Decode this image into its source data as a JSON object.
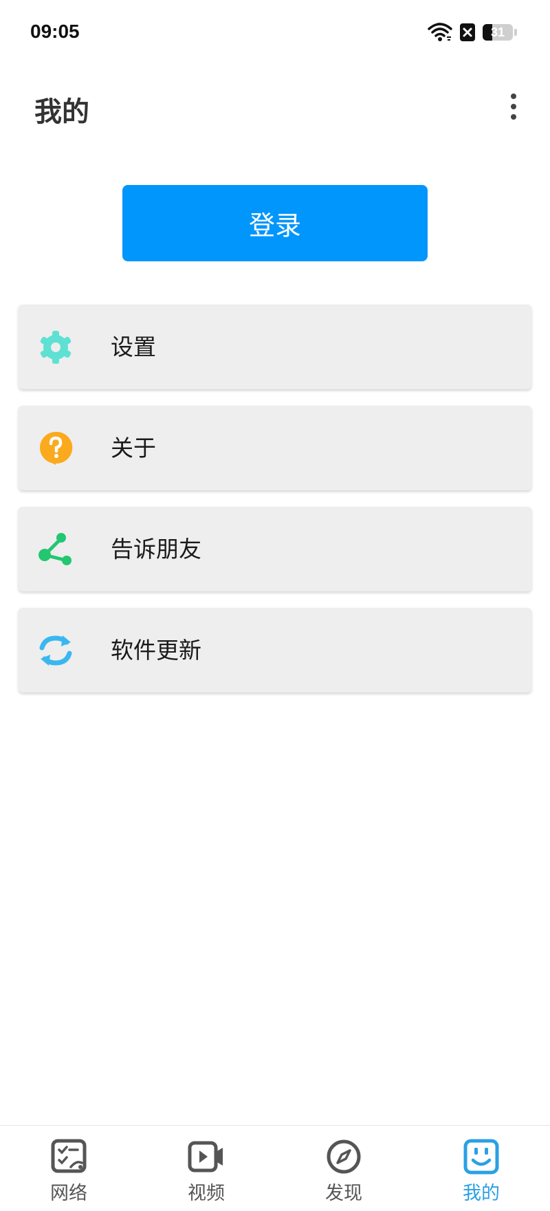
{
  "status_bar": {
    "time": "09:05",
    "battery_level": "31",
    "battery_fraction": 0.31
  },
  "header": {
    "title": "我的"
  },
  "login_label": "登录",
  "menu": [
    {
      "label": "设置",
      "icon": "gear-icon",
      "color": "#5ee1d2"
    },
    {
      "label": "关于",
      "icon": "help-icon",
      "color": "#fbaa1d"
    },
    {
      "label": "告诉朋友",
      "icon": "share-icon",
      "color": "#22c770"
    },
    {
      "label": "软件更新",
      "icon": "refresh-icon",
      "color": "#3bb7f0"
    }
  ],
  "tabs": [
    {
      "label": "网络",
      "icon": "network-icon",
      "active": false
    },
    {
      "label": "视频",
      "icon": "video-icon",
      "active": false
    },
    {
      "label": "发现",
      "icon": "compass-icon",
      "active": false
    },
    {
      "label": "我的",
      "icon": "smiley-icon",
      "active": true
    }
  ],
  "colors": {
    "accent": "#0196fb",
    "tab_active": "#2aa0e4",
    "tab_inactive": "#555555"
  }
}
